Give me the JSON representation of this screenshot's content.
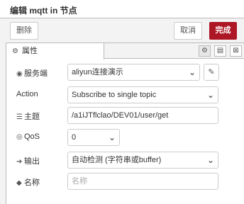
{
  "header": {
    "title": "编辑 mqtt in 节点"
  },
  "actions": {
    "delete_label": "删除",
    "cancel_label": "取消",
    "done_label": "完成",
    "accent_color": "#ad1625"
  },
  "tab": {
    "label": "属性",
    "icon": "gear-icon"
  },
  "tools": [
    {
      "icon": "gear-icon"
    },
    {
      "icon": "document-icon"
    },
    {
      "icon": "frame-icon"
    }
  ],
  "form": {
    "server": {
      "label": "服务端",
      "icon": "globe-icon",
      "value": "aliyun连接演示",
      "edit_icon": "pencil-icon"
    },
    "action": {
      "label": "Action",
      "value": "Subscribe to single topic"
    },
    "topic": {
      "label": "主题",
      "icon": "tasks-icon",
      "value": "/a1iJTflclao/DEV01/user/get"
    },
    "qos": {
      "label": "QoS",
      "icon": "radio-icon",
      "value": "0"
    },
    "output": {
      "label": "输出",
      "icon": "sign-out-icon",
      "value": "自动检测 (字符串或buffer)"
    },
    "name": {
      "label": "名称",
      "icon": "tag-icon",
      "value": "",
      "placeholder": "名称"
    }
  }
}
